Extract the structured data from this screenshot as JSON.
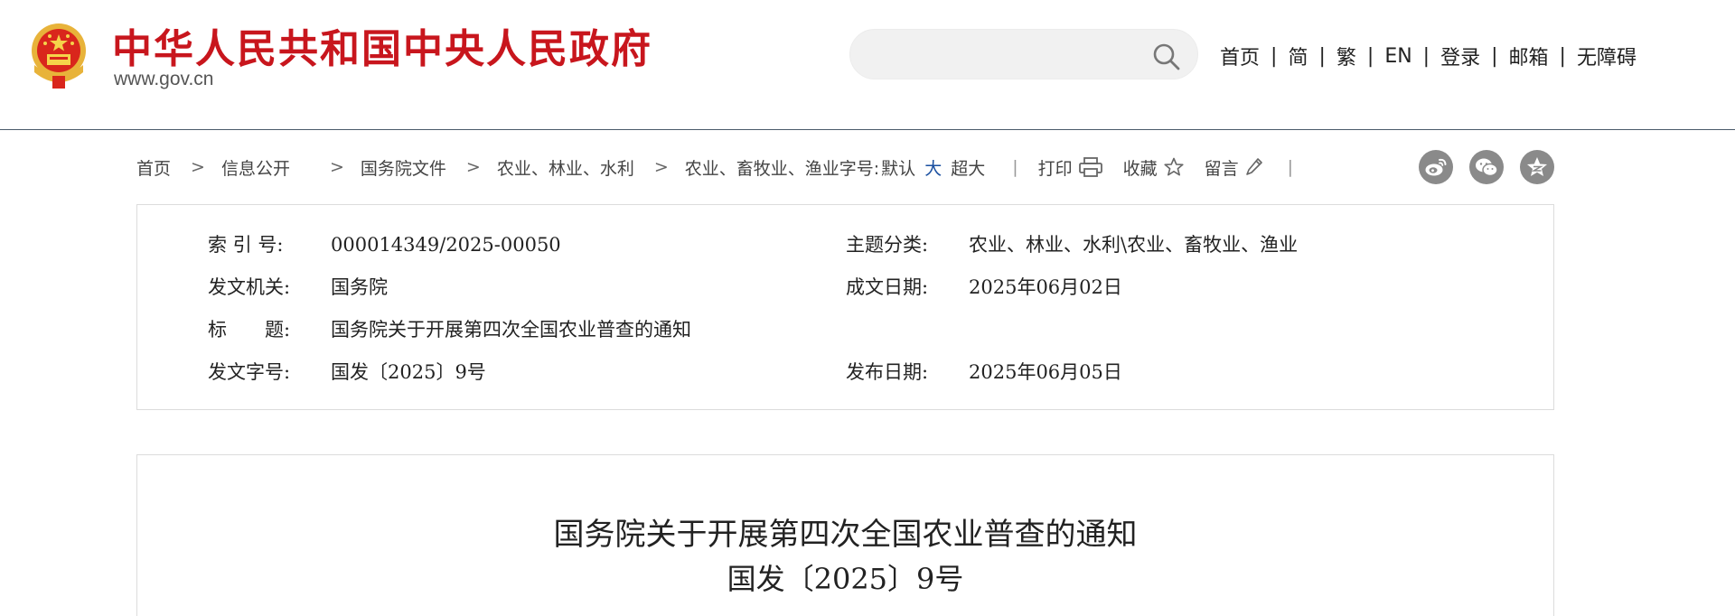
{
  "header": {
    "site_name": "中华人民共和国中央人民政府",
    "site_url": "www.gov.cn",
    "emblem_icon": "national-emblem-icon",
    "brand_color": "#c8161d"
  },
  "search": {
    "placeholder": "",
    "icon": "search-icon"
  },
  "top_nav": {
    "items": [
      "首页",
      "简",
      "繁",
      "EN",
      "登录",
      "邮箱",
      "无障碍"
    ],
    "separator": "|"
  },
  "breadcrumb": {
    "items": [
      "首页",
      "信息公开",
      "国务院文件",
      "农业、林业、水利",
      "农业、畜牧业、渔业"
    ],
    "arrow": ">"
  },
  "font_size": {
    "label": "字号:",
    "options": [
      "默认",
      "大",
      "超大"
    ],
    "active": "大",
    "active_color": "#1a4fa0"
  },
  "tools": {
    "divider": "|",
    "print": "打印",
    "favorite": "收藏",
    "comment": "留言"
  },
  "share": {
    "icons": [
      "weibo-icon",
      "wechat-icon",
      "qzone-icon"
    ]
  },
  "info": {
    "index_label": "索 引 号:",
    "index_value": "000014349/2025-00050",
    "topic_label": "主题分类:",
    "topic_value": "农业、林业、水利\\农业、畜牧业、渔业",
    "issuer_label": "发文机关:",
    "issuer_value": "国务院",
    "written_date_label": "成文日期:",
    "written_date_value": "2025年06月02日",
    "title_label": "标　　题:",
    "title_value": "国务院关于开展第四次全国农业普查的通知",
    "doc_no_label": "发文字号:",
    "doc_no_value": "国发〔2025〕9号",
    "publish_date_label": "发布日期:",
    "publish_date_value": "2025年06月05日"
  },
  "article": {
    "title": "国务院关于开展第四次全国农业普查的通知",
    "doc_number": "国发〔2025〕9号"
  }
}
